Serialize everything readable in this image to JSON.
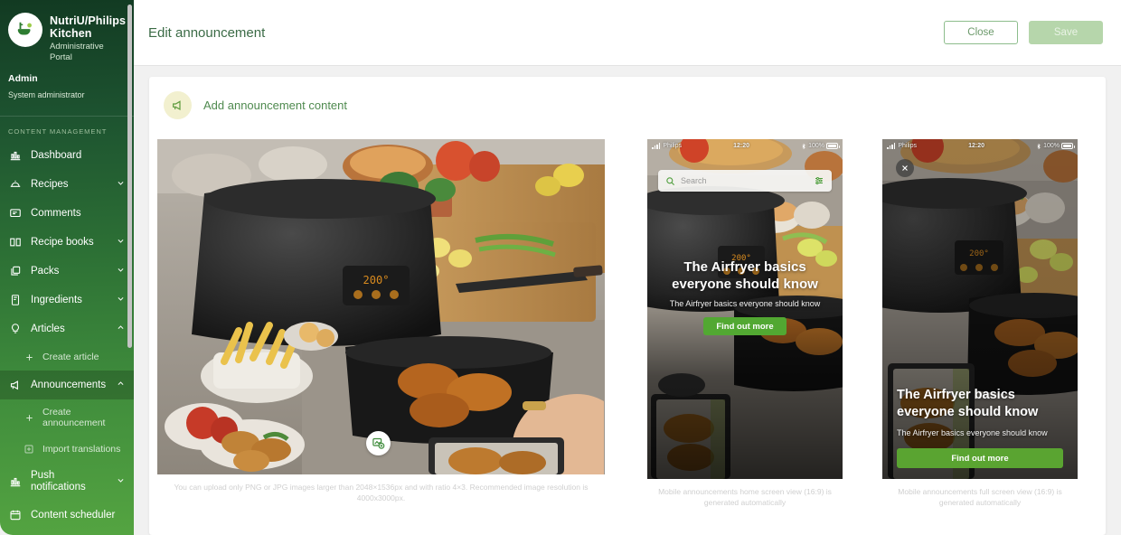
{
  "sidebar": {
    "brand_name": "NutriU/Philips Kitchen",
    "brand_sub": "Administrative Portal",
    "admin_label": "Admin",
    "admin_role": "System administrator",
    "section_label": "CONTENT MANAGEMENT",
    "items": [
      {
        "label": "Dashboard",
        "icon": "chart-bar-icon",
        "chevron": "",
        "active": false
      },
      {
        "label": "Recipes",
        "icon": "recipe-icon",
        "chevron": "down",
        "active": false
      },
      {
        "label": "Comments",
        "icon": "comment-icon",
        "chevron": "",
        "active": false
      },
      {
        "label": "Recipe books",
        "icon": "book-icon",
        "chevron": "down",
        "active": false
      },
      {
        "label": "Packs",
        "icon": "packs-icon",
        "chevron": "down",
        "active": false
      },
      {
        "label": "Ingredients",
        "icon": "ingredients-icon",
        "chevron": "down",
        "active": false
      },
      {
        "label": "Articles",
        "icon": "bulb-icon",
        "chevron": "up",
        "active": false
      },
      {
        "label": "Announcements",
        "icon": "megaphone-icon",
        "chevron": "up",
        "active": true
      },
      {
        "label": "Push notifications",
        "icon": "chart-bar-icon",
        "chevron": "down",
        "active": false
      },
      {
        "label": "Content scheduler",
        "icon": "calendar-icon",
        "chevron": "",
        "active": false
      }
    ],
    "sub_create_article": "Create article",
    "sub_create_announcement": "Create announcement",
    "sub_import_translations": "Import translations"
  },
  "header": {
    "title": "Edit announcement",
    "close_label": "Close",
    "save_label": "Save"
  },
  "content": {
    "section_title": "Add announcement content",
    "section_icon": "megaphone-icon",
    "hero_caption": "You can upload only PNG or JPG images larger than 2048×1536px and with ratio 4×3. Recommended image resolution is 4000x3000px.",
    "edit_image_icon": "image-edit-icon"
  },
  "phone_home": {
    "status_carrier": "Philips",
    "status_time": "12:20",
    "status_battery": "100%",
    "search_placeholder": "Search",
    "search_icon": "search-icon",
    "filter_icon": "filter-sliders-icon",
    "title": "The Airfryer basics everyone should know",
    "subtitle": "The Airfryer basics everyone should know",
    "cta_label": "Find out more",
    "caption": "Mobile announcements home screen view (16:9) is generated automatically"
  },
  "phone_full": {
    "status_carrier": "Philips",
    "status_time": "12:20",
    "status_battery": "100%",
    "close_icon": "close-icon",
    "title": "The Airfryer basics everyone should know",
    "subtitle": "The Airfryer basics everyone should know",
    "cta_label": "Find out more",
    "caption": "Mobile announcements full screen view (16:9) is generated automatically"
  },
  "colors": {
    "brand_green": "#3b6b46",
    "cta_green": "#52a832",
    "sidebar_top": "#123a22",
    "sidebar_bottom": "#54a441",
    "section_icon_bg": "#f2f0cf"
  }
}
